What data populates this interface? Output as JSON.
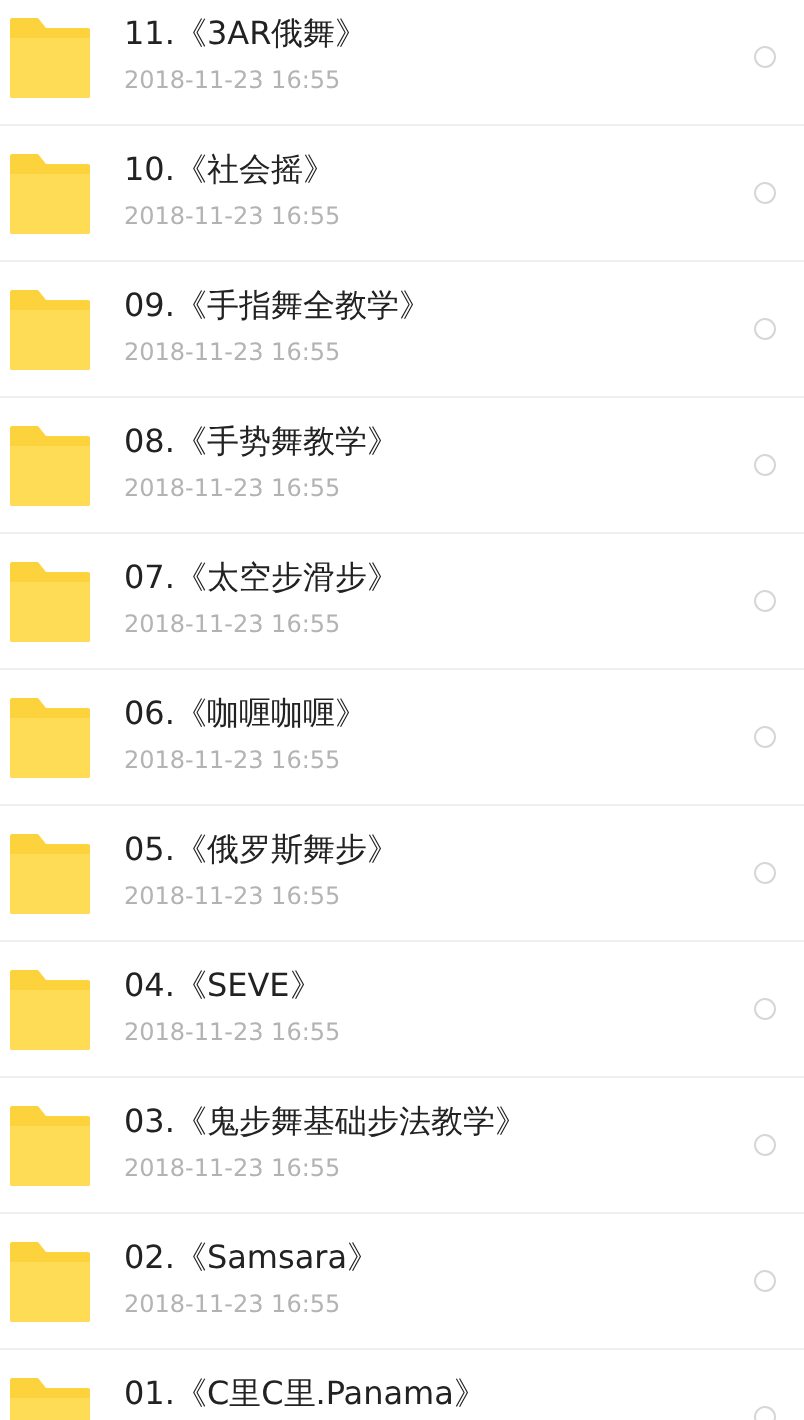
{
  "files": [
    {
      "name": "11.《3AR俄舞》",
      "date": "2018-11-23  16:55",
      "selected": false
    },
    {
      "name": "10.《社会摇》",
      "date": "2018-11-23  16:55",
      "selected": false
    },
    {
      "name": "09.《手指舞全教学》",
      "date": "2018-11-23  16:55",
      "selected": false
    },
    {
      "name": "08.《手势舞教学》",
      "date": "2018-11-23  16:55",
      "selected": false
    },
    {
      "name": "07.《太空步滑步》",
      "date": "2018-11-23  16:55",
      "selected": false
    },
    {
      "name": "06.《咖喱咖喱》",
      "date": "2018-11-23  16:55",
      "selected": false
    },
    {
      "name": "05.《俄罗斯舞步》",
      "date": "2018-11-23  16:55",
      "selected": false
    },
    {
      "name": "04.《SEVE》",
      "date": "2018-11-23  16:55",
      "selected": false
    },
    {
      "name": "03.《鬼步舞基础步法教学》",
      "date": "2018-11-23  16:55",
      "selected": false
    },
    {
      "name": "02.《Samsara》",
      "date": "2018-11-23  16:55",
      "selected": false
    },
    {
      "name": "01.《C里C里.Panama》",
      "selected": false
    }
  ]
}
